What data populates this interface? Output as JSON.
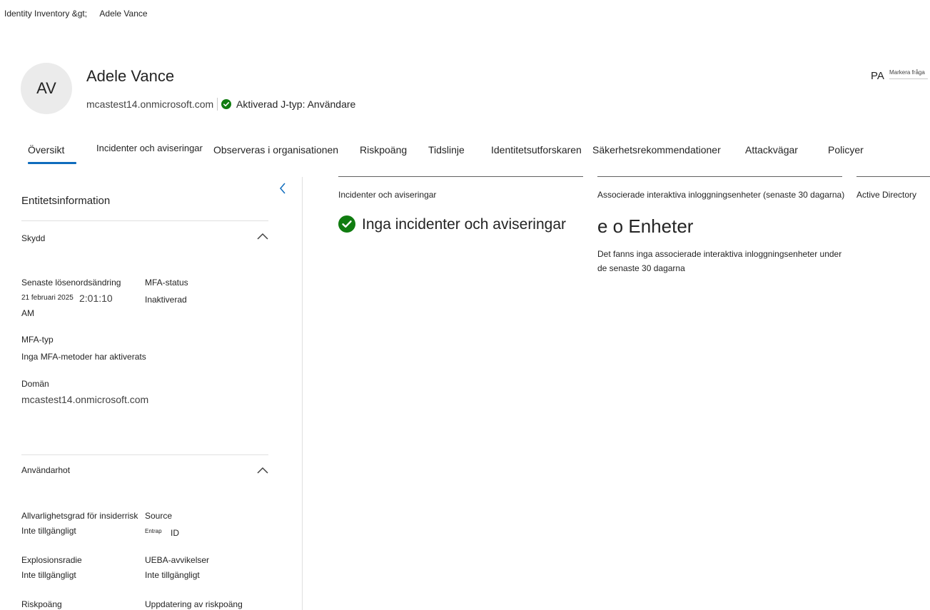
{
  "breadcrumb": {
    "root": "Identity Inventory &gt;",
    "current": "Adele Vance"
  },
  "header": {
    "initials": "AV",
    "name": "Adele Vance",
    "domain": "mcastest14.onmicrosoft.com",
    "status": "Aktiverad J-typ: Användare",
    "right_initials": "PA",
    "right_label": "Markera fråga"
  },
  "tabs": [
    "Översikt",
    "Incidenter och aviseringar",
    "Observeras i organisationen",
    "Riskpoäng",
    "Tidslinje",
    "Identitetsutforskaren",
    "Säkerhetsrekommendationer",
    "Attackvägar",
    "Policyer"
  ],
  "sidebar": {
    "title": "Entitetsinformation",
    "protection": {
      "title": "Skydd",
      "pwd_label": "Senaste lösenordsändring",
      "pwd_date": "21 februari 2025",
      "pwd_time": "2:01:10",
      "pwd_ampm": "AM",
      "mfa_status_label": "MFA-status",
      "mfa_status_value": "Inaktiverad",
      "mfa_type_label": "MFA-typ",
      "mfa_type_value": "Inga MFA-metoder har aktiverats",
      "domain_label": "Domän",
      "domain_value": "mcastest14.onmicrosoft.com"
    },
    "threat": {
      "title": "Användarhot",
      "insider_label": "Allvarlighetsgrad för insiderrisk",
      "insider_value": "Inte tillgängligt",
      "source_label": "Source",
      "source_prefix": "Entrap",
      "source_value": "ID",
      "blast_label": "Explosionsradie",
      "blast_value": "Inte tillgängligt",
      "ueba_label": "UEBA-avvikelser",
      "ueba_value": "Inte tillgängligt",
      "risk_label": "Riskpoäng",
      "risk_update_label": "Uppdatering av riskpoäng"
    }
  },
  "cards": {
    "incidents": {
      "title": "Incidenter och aviseringar",
      "message": "Inga incidenter och aviseringar"
    },
    "devices": {
      "title": "Associerade interaktiva inloggningsenheter (senaste 30 dagarna)",
      "heading": "e o Enheter",
      "desc_line1": "Det fanns inga associerade interaktiva inloggningsenheter under",
      "desc_line2": "de senaste 30 dagarna"
    },
    "ad": {
      "title": "Active Directory"
    }
  },
  "colors": {
    "accent": "#0f6cbd",
    "success": "#107c10"
  }
}
